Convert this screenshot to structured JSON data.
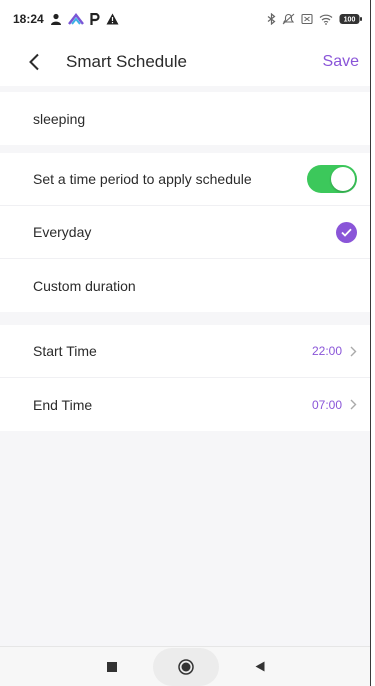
{
  "status_bar": {
    "time": "18:24",
    "left_icons": [
      "person-icon",
      "app-icon",
      "parking-icon",
      "warning-icon"
    ],
    "right_icons": [
      "bluetooth-icon",
      "mute-icon",
      "sim-icon",
      "wifi-icon",
      "battery-icon"
    ],
    "battery": "100"
  },
  "header": {
    "title": "Smart Schedule",
    "save_label": "Save",
    "accent_color": "#8a55d8"
  },
  "schedule_name": "sleeping",
  "time_period": {
    "label": "Set a time period to apply schedule",
    "enabled": true,
    "toggle_color": "#3cc85b"
  },
  "duration_options": [
    {
      "label": "Everyday",
      "selected": true
    },
    {
      "label": "Custom duration",
      "selected": false
    }
  ],
  "times": [
    {
      "label": "Start Time",
      "value": "22:00"
    },
    {
      "label": "End Time",
      "value": "07:00"
    }
  ],
  "nav_bar": {
    "icons": [
      "recents-square-icon",
      "home-circle-icon",
      "back-triangle-icon"
    ]
  }
}
